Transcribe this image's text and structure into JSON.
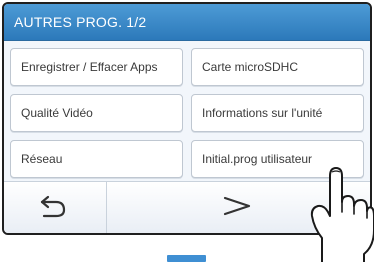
{
  "header": {
    "title": "AUTRES PROG. 1/2"
  },
  "menu": [
    {
      "label": "Enregistrer / Effacer Apps"
    },
    {
      "label": "Carte microSDHC"
    },
    {
      "label": "Qualité Vidéo"
    },
    {
      "label": "Informations sur l'unité"
    },
    {
      "label": "Réseau"
    },
    {
      "label": "Initial.prog utilisateur"
    }
  ],
  "nav": {
    "back_icon": "back-arrow-icon",
    "next_icon": "next-chevron-icon"
  },
  "colors": {
    "header_top": "#4d9bd6",
    "header_bottom": "#2c79ba",
    "indicator": "#3f8fd3"
  }
}
